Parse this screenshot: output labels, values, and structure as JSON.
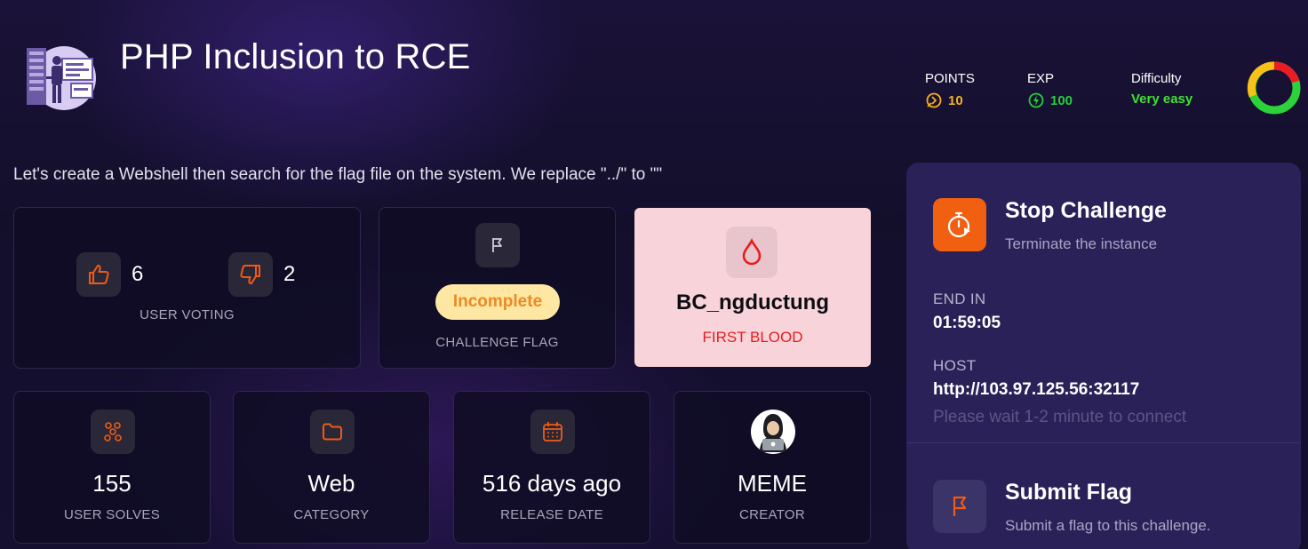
{
  "header": {
    "title": "PHP Inclusion to RCE",
    "points_label": "POINTS",
    "points_value": "10",
    "exp_label": "EXP",
    "exp_value": "100",
    "difficulty_label": "Difficulty",
    "difficulty_value": "Very easy"
  },
  "description": "Let's create a Webshell then search for the flag file on the system. We replace \"../\" to \"\"",
  "voting": {
    "up": "6",
    "down": "2",
    "label": "USER VOTING"
  },
  "flag": {
    "status": "Incomplete",
    "label": "CHALLENGE FLAG"
  },
  "first_blood": {
    "user": "BC_ngductung",
    "label": "FIRST BLOOD"
  },
  "stats": [
    {
      "value": "155",
      "label": "USER SOLVES",
      "icon": "users-icon"
    },
    {
      "value": "Web",
      "label": "CATEGORY",
      "icon": "folder-icon"
    },
    {
      "value": "516 days ago",
      "label": "RELEASE DATE",
      "icon": "calendar-icon"
    },
    {
      "value": "MEME",
      "label": "CREATOR",
      "icon": "hacker-avatar"
    }
  ],
  "panel": {
    "stop_title": "Stop Challenge",
    "stop_sub": "Terminate the instance",
    "end_label": "END IN",
    "end_value": "01:59:05",
    "host_label": "HOST",
    "host_value": "http://103.97.125.56:32117",
    "wait_text": "Please wait 1-2 minute to connect",
    "submit_title": "Submit Flag",
    "submit_sub": "Submit a flag to this challenge."
  },
  "colors": {
    "accent_orange": "#f06010",
    "points": "#f5b21b",
    "exp": "#22d039",
    "difficulty": "#3ee22f",
    "first_blood_bg": "#f9d3da",
    "first_blood_text": "#e81c1c",
    "pill_bg": "#fde7a3",
    "pill_text": "#ec8a24",
    "panel_bg": "#2a2159"
  }
}
